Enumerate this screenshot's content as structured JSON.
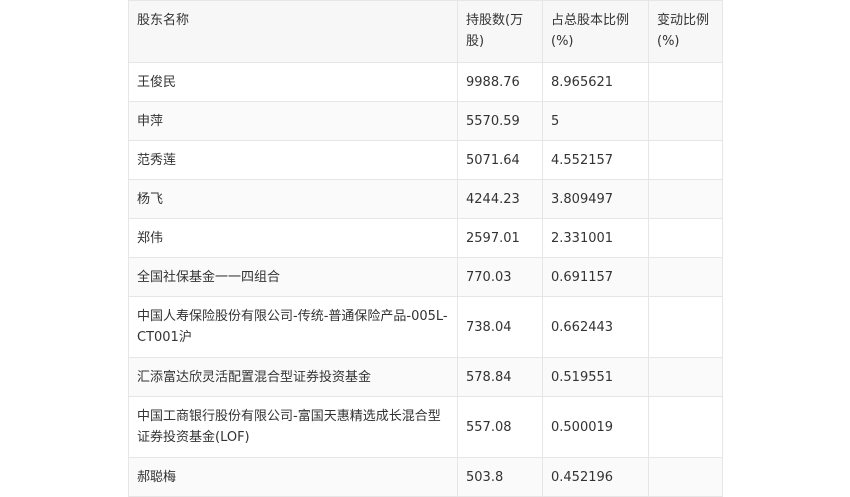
{
  "table": {
    "headers": [
      "股东名称",
      "持股数(万股)",
      "占总股本比例(%)",
      "变动比例(%)"
    ],
    "rows": [
      {
        "name": "王俊民",
        "shares": "9988.76",
        "ratio": "8.965621",
        "change": ""
      },
      {
        "name": "申萍",
        "shares": "5570.59",
        "ratio": "5",
        "change": ""
      },
      {
        "name": "范秀莲",
        "shares": "5071.64",
        "ratio": "4.552157",
        "change": ""
      },
      {
        "name": "杨飞",
        "shares": "4244.23",
        "ratio": "3.809497",
        "change": ""
      },
      {
        "name": "郑伟",
        "shares": "2597.01",
        "ratio": "2.331001",
        "change": ""
      },
      {
        "name": "全国社保基金一一四组合",
        "shares": "770.03",
        "ratio": "0.691157",
        "change": ""
      },
      {
        "name": "中国人寿保险股份有限公司-传统-普通保险产品-005L-CT001沪",
        "shares": "738.04",
        "ratio": "0.662443",
        "change": ""
      },
      {
        "name": "汇添富达欣灵活配置混合型证券投资基金",
        "shares": "578.84",
        "ratio": "0.519551",
        "change": ""
      },
      {
        "name": "中国工商银行股份有限公司-富国天惠精选成长混合型证券投资基金(LOF)",
        "shares": "557.08",
        "ratio": "0.500019",
        "change": ""
      },
      {
        "name": "郝聪梅",
        "shares": "503.8",
        "ratio": "0.452196",
        "change": ""
      }
    ]
  }
}
